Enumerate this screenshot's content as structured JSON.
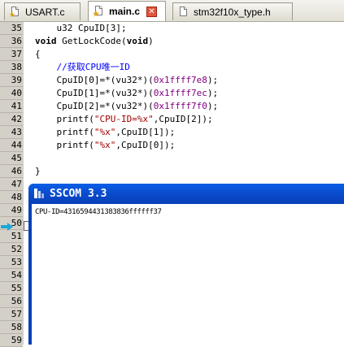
{
  "tabs": [
    {
      "label": "USART.c",
      "active": false
    },
    {
      "label": "main.c",
      "active": true
    },
    {
      "label": "stm32f10x_type.h",
      "active": false
    }
  ],
  "line_numbers": [
    "35",
    "36",
    "37",
    "38",
    "39",
    "40",
    "41",
    "42",
    "43",
    "44",
    "45",
    "46",
    "47",
    "48",
    "49",
    "50",
    "51",
    "52",
    "53",
    "54",
    "55",
    "56",
    "57",
    "58",
    "59"
  ],
  "code": {
    "l35": {
      "a": "    u32 CpuID[3];"
    },
    "l36": {
      "kw1": "void",
      "a": " GetLockCode(",
      "kw2": "void",
      "b": ")"
    },
    "l37": {
      "a": "{"
    },
    "l38": {
      "cm": "    //获取CPU唯一ID"
    },
    "l39": {
      "a": "    CpuID[0]=*(vu32*)(",
      "num": "0x1ffff7e8",
      "b": ");"
    },
    "l40": {
      "a": "    CpuID[1]=*(vu32*)(",
      "num": "0x1ffff7ec",
      "b": ");"
    },
    "l41": {
      "a": "    CpuID[2]=*(vu32*)(",
      "num": "0x1ffff7f0",
      "b": ");"
    },
    "l42": {
      "a": "    printf(",
      "str": "\"CPU-ID=%x\"",
      "b": ",CpuID[2]);"
    },
    "l43": {
      "a": "    printf(",
      "str": "\"%x\"",
      "b": ",CpuID[1]);"
    },
    "l44": {
      "a": "    printf(",
      "str": "\"%x\"",
      "b": ",CpuID[0]);"
    },
    "l46": {
      "a": "}"
    }
  },
  "sscom": {
    "title": "SSCOM 3.3",
    "received_text": "CPU-ID=4316594431383836ffffff37"
  },
  "colors": {
    "titlebar": "#0a48c8",
    "comment": "#0000ff",
    "number": "#800080",
    "string": "#a00000",
    "close_tab": "#e2543b"
  }
}
